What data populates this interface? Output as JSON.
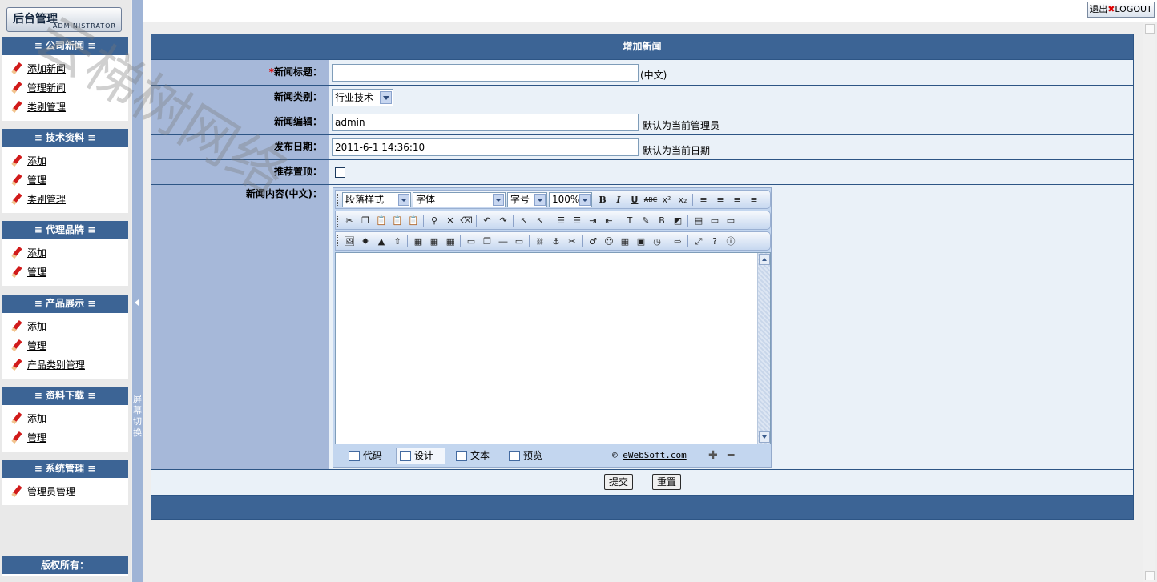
{
  "sidebar": {
    "logo_title": "后台管理",
    "logo_sub": "ADMINISTRATOR",
    "groups": [
      {
        "title": "公司新闻",
        "items": [
          "添加新闻",
          "管理新闻",
          "类别管理"
        ]
      },
      {
        "title": "技术资料",
        "items": [
          "添加",
          "管理",
          "类别管理"
        ]
      },
      {
        "title": "代理品牌",
        "items": [
          "添加",
          "管理"
        ]
      },
      {
        "title": "产品展示",
        "items": [
          "添加",
          "管理",
          "产品类别管理"
        ]
      },
      {
        "title": "资料下载",
        "items": [
          "添加",
          "管理"
        ]
      },
      {
        "title": "系统管理",
        "items": [
          "管理员管理"
        ]
      }
    ],
    "copyright": "版权所有："
  },
  "splitter": {
    "label": "屏幕切换"
  },
  "topbar": {
    "logout_cn": "退出",
    "logout_en": "LOGOUT"
  },
  "form": {
    "title": "增加新闻",
    "title_label": "新闻标题：",
    "title_value": "",
    "title_hint": "(中文)",
    "category_label": "新闻类别：",
    "category_value": "行业技术",
    "editor_label": "新闻编辑：",
    "editor_value": "admin",
    "editor_hint": "默认为当前管理员",
    "date_label": "发布日期：",
    "date_value": "2011-6-1 14:36:10",
    "date_hint": "默认为当前日期",
    "recommend_label": "推荐置顶：",
    "content_label": "新闻内容(中文)：",
    "submit_label": "提交",
    "reset_label": "重置"
  },
  "editor": {
    "paragraph_style": "段落样式",
    "font": "字体",
    "font_size": "字号",
    "zoom": "100%",
    "tabs": [
      "代码",
      "设计",
      "文本",
      "预览"
    ],
    "active_tab": "设计",
    "brand_prefix": "©",
    "brand_link": "eWebSoft.com"
  },
  "watermark": "云梯树网络"
}
